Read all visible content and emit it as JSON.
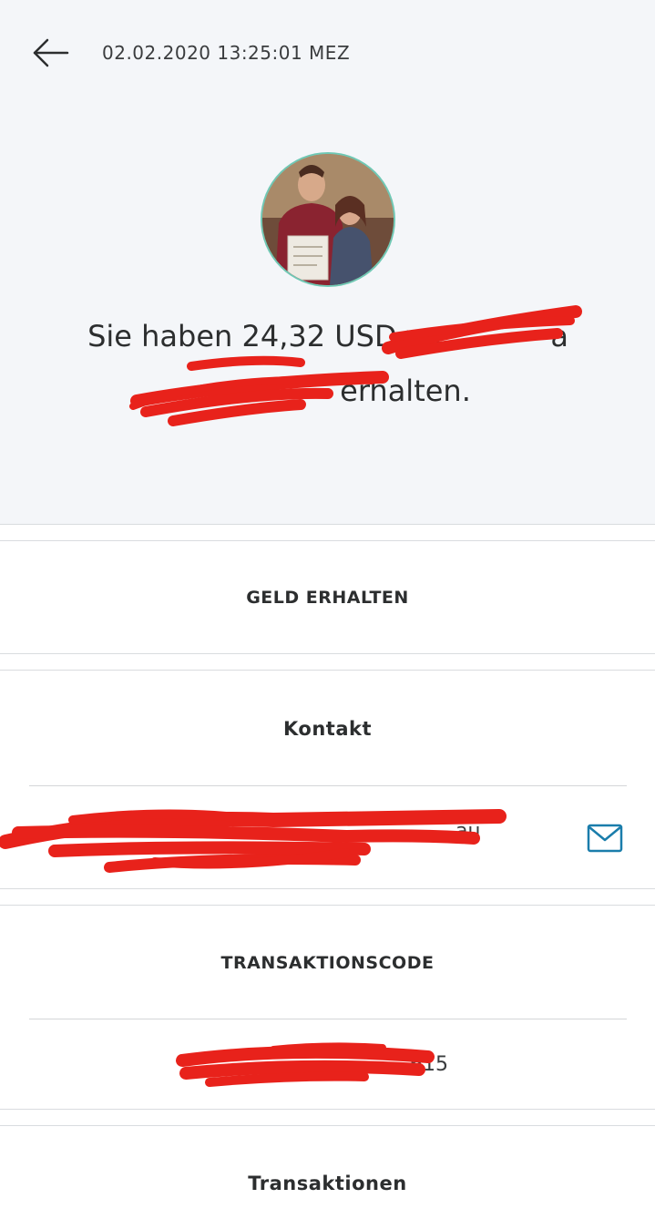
{
  "header": {
    "timestamp": "02.02.2020 13:25:01 MEZ",
    "headline_line1": "Sie haben 24,32 USD vo",
    "headline_line1_end": "a",
    "headline_line2": "erhalten."
  },
  "sections": {
    "status_label": "GELD ERHALTEN",
    "contact_title": "Kontakt",
    "contact_email_tail": "au",
    "code_title": "TRANSAKTIONSCODE",
    "code_value_tail": "615",
    "transactions_title": "Transaktionen"
  },
  "icons": {
    "back": "arrow-left-icon",
    "mail": "mail-icon"
  },
  "colors": {
    "accent": "#1a7dab",
    "redaction": "#e8221b",
    "header_bg": "#f4f6f9"
  }
}
